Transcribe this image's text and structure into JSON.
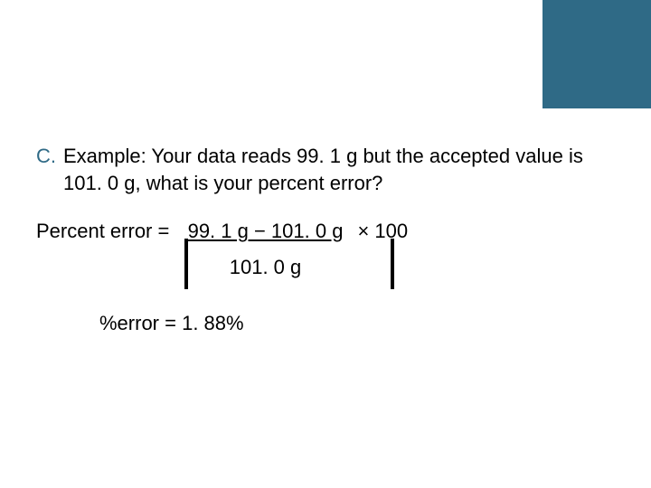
{
  "accent_color": "#2f6a86",
  "list": {
    "letter": "C.",
    "text": "Example: Your data reads 99. 1 g but the accepted value is 101. 0 g, what is your percent error?"
  },
  "formula": {
    "label": "Percent error =",
    "numerator": "99. 1 g − 101. 0 g",
    "denominator": "101. 0 g",
    "times": "× 100"
  },
  "result": "%error = 1. 88%"
}
